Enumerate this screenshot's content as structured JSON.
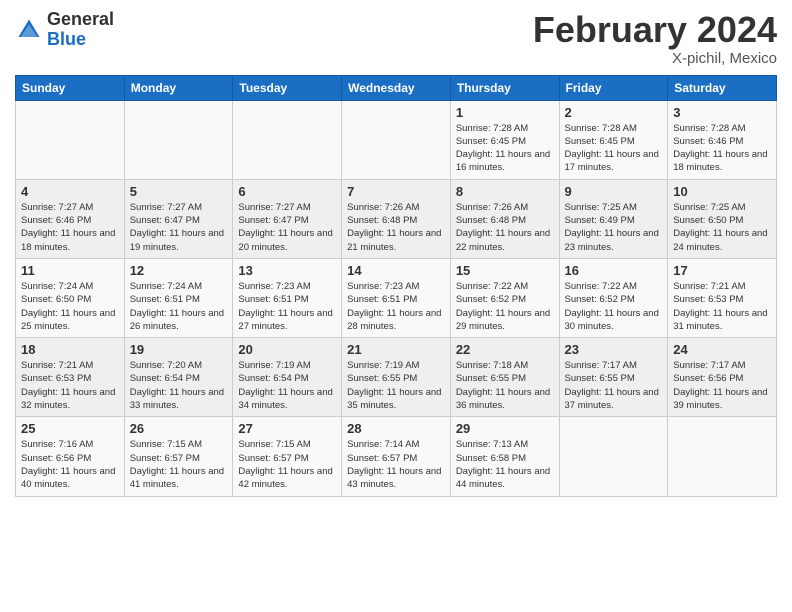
{
  "header": {
    "logo_general": "General",
    "logo_blue": "Blue",
    "month_title": "February 2024",
    "location": "X-pichil, Mexico"
  },
  "days_of_week": [
    "Sunday",
    "Monday",
    "Tuesday",
    "Wednesday",
    "Thursday",
    "Friday",
    "Saturday"
  ],
  "weeks": [
    [
      {
        "day": "",
        "sunrise": "",
        "sunset": "",
        "daylight": ""
      },
      {
        "day": "",
        "sunrise": "",
        "sunset": "",
        "daylight": ""
      },
      {
        "day": "",
        "sunrise": "",
        "sunset": "",
        "daylight": ""
      },
      {
        "day": "",
        "sunrise": "",
        "sunset": "",
        "daylight": ""
      },
      {
        "day": "1",
        "sunrise": "Sunrise: 7:28 AM",
        "sunset": "Sunset: 6:45 PM",
        "daylight": "Daylight: 11 hours and 16 minutes."
      },
      {
        "day": "2",
        "sunrise": "Sunrise: 7:28 AM",
        "sunset": "Sunset: 6:45 PM",
        "daylight": "Daylight: 11 hours and 17 minutes."
      },
      {
        "day": "3",
        "sunrise": "Sunrise: 7:28 AM",
        "sunset": "Sunset: 6:46 PM",
        "daylight": "Daylight: 11 hours and 18 minutes."
      }
    ],
    [
      {
        "day": "4",
        "sunrise": "Sunrise: 7:27 AM",
        "sunset": "Sunset: 6:46 PM",
        "daylight": "Daylight: 11 hours and 18 minutes."
      },
      {
        "day": "5",
        "sunrise": "Sunrise: 7:27 AM",
        "sunset": "Sunset: 6:47 PM",
        "daylight": "Daylight: 11 hours and 19 minutes."
      },
      {
        "day": "6",
        "sunrise": "Sunrise: 7:27 AM",
        "sunset": "Sunset: 6:47 PM",
        "daylight": "Daylight: 11 hours and 20 minutes."
      },
      {
        "day": "7",
        "sunrise": "Sunrise: 7:26 AM",
        "sunset": "Sunset: 6:48 PM",
        "daylight": "Daylight: 11 hours and 21 minutes."
      },
      {
        "day": "8",
        "sunrise": "Sunrise: 7:26 AM",
        "sunset": "Sunset: 6:48 PM",
        "daylight": "Daylight: 11 hours and 22 minutes."
      },
      {
        "day": "9",
        "sunrise": "Sunrise: 7:25 AM",
        "sunset": "Sunset: 6:49 PM",
        "daylight": "Daylight: 11 hours and 23 minutes."
      },
      {
        "day": "10",
        "sunrise": "Sunrise: 7:25 AM",
        "sunset": "Sunset: 6:50 PM",
        "daylight": "Daylight: 11 hours and 24 minutes."
      }
    ],
    [
      {
        "day": "11",
        "sunrise": "Sunrise: 7:24 AM",
        "sunset": "Sunset: 6:50 PM",
        "daylight": "Daylight: 11 hours and 25 minutes."
      },
      {
        "day": "12",
        "sunrise": "Sunrise: 7:24 AM",
        "sunset": "Sunset: 6:51 PM",
        "daylight": "Daylight: 11 hours and 26 minutes."
      },
      {
        "day": "13",
        "sunrise": "Sunrise: 7:23 AM",
        "sunset": "Sunset: 6:51 PM",
        "daylight": "Daylight: 11 hours and 27 minutes."
      },
      {
        "day": "14",
        "sunrise": "Sunrise: 7:23 AM",
        "sunset": "Sunset: 6:51 PM",
        "daylight": "Daylight: 11 hours and 28 minutes."
      },
      {
        "day": "15",
        "sunrise": "Sunrise: 7:22 AM",
        "sunset": "Sunset: 6:52 PM",
        "daylight": "Daylight: 11 hours and 29 minutes."
      },
      {
        "day": "16",
        "sunrise": "Sunrise: 7:22 AM",
        "sunset": "Sunset: 6:52 PM",
        "daylight": "Daylight: 11 hours and 30 minutes."
      },
      {
        "day": "17",
        "sunrise": "Sunrise: 7:21 AM",
        "sunset": "Sunset: 6:53 PM",
        "daylight": "Daylight: 11 hours and 31 minutes."
      }
    ],
    [
      {
        "day": "18",
        "sunrise": "Sunrise: 7:21 AM",
        "sunset": "Sunset: 6:53 PM",
        "daylight": "Daylight: 11 hours and 32 minutes."
      },
      {
        "day": "19",
        "sunrise": "Sunrise: 7:20 AM",
        "sunset": "Sunset: 6:54 PM",
        "daylight": "Daylight: 11 hours and 33 minutes."
      },
      {
        "day": "20",
        "sunrise": "Sunrise: 7:19 AM",
        "sunset": "Sunset: 6:54 PM",
        "daylight": "Daylight: 11 hours and 34 minutes."
      },
      {
        "day": "21",
        "sunrise": "Sunrise: 7:19 AM",
        "sunset": "Sunset: 6:55 PM",
        "daylight": "Daylight: 11 hours and 35 minutes."
      },
      {
        "day": "22",
        "sunrise": "Sunrise: 7:18 AM",
        "sunset": "Sunset: 6:55 PM",
        "daylight": "Daylight: 11 hours and 36 minutes."
      },
      {
        "day": "23",
        "sunrise": "Sunrise: 7:17 AM",
        "sunset": "Sunset: 6:55 PM",
        "daylight": "Daylight: 11 hours and 37 minutes."
      },
      {
        "day": "24",
        "sunrise": "Sunrise: 7:17 AM",
        "sunset": "Sunset: 6:56 PM",
        "daylight": "Daylight: 11 hours and 39 minutes."
      }
    ],
    [
      {
        "day": "25",
        "sunrise": "Sunrise: 7:16 AM",
        "sunset": "Sunset: 6:56 PM",
        "daylight": "Daylight: 11 hours and 40 minutes."
      },
      {
        "day": "26",
        "sunrise": "Sunrise: 7:15 AM",
        "sunset": "Sunset: 6:57 PM",
        "daylight": "Daylight: 11 hours and 41 minutes."
      },
      {
        "day": "27",
        "sunrise": "Sunrise: 7:15 AM",
        "sunset": "Sunset: 6:57 PM",
        "daylight": "Daylight: 11 hours and 42 minutes."
      },
      {
        "day": "28",
        "sunrise": "Sunrise: 7:14 AM",
        "sunset": "Sunset: 6:57 PM",
        "daylight": "Daylight: 11 hours and 43 minutes."
      },
      {
        "day": "29",
        "sunrise": "Sunrise: 7:13 AM",
        "sunset": "Sunset: 6:58 PM",
        "daylight": "Daylight: 11 hours and 44 minutes."
      },
      {
        "day": "",
        "sunrise": "",
        "sunset": "",
        "daylight": ""
      },
      {
        "day": "",
        "sunrise": "",
        "sunset": "",
        "daylight": ""
      }
    ]
  ]
}
